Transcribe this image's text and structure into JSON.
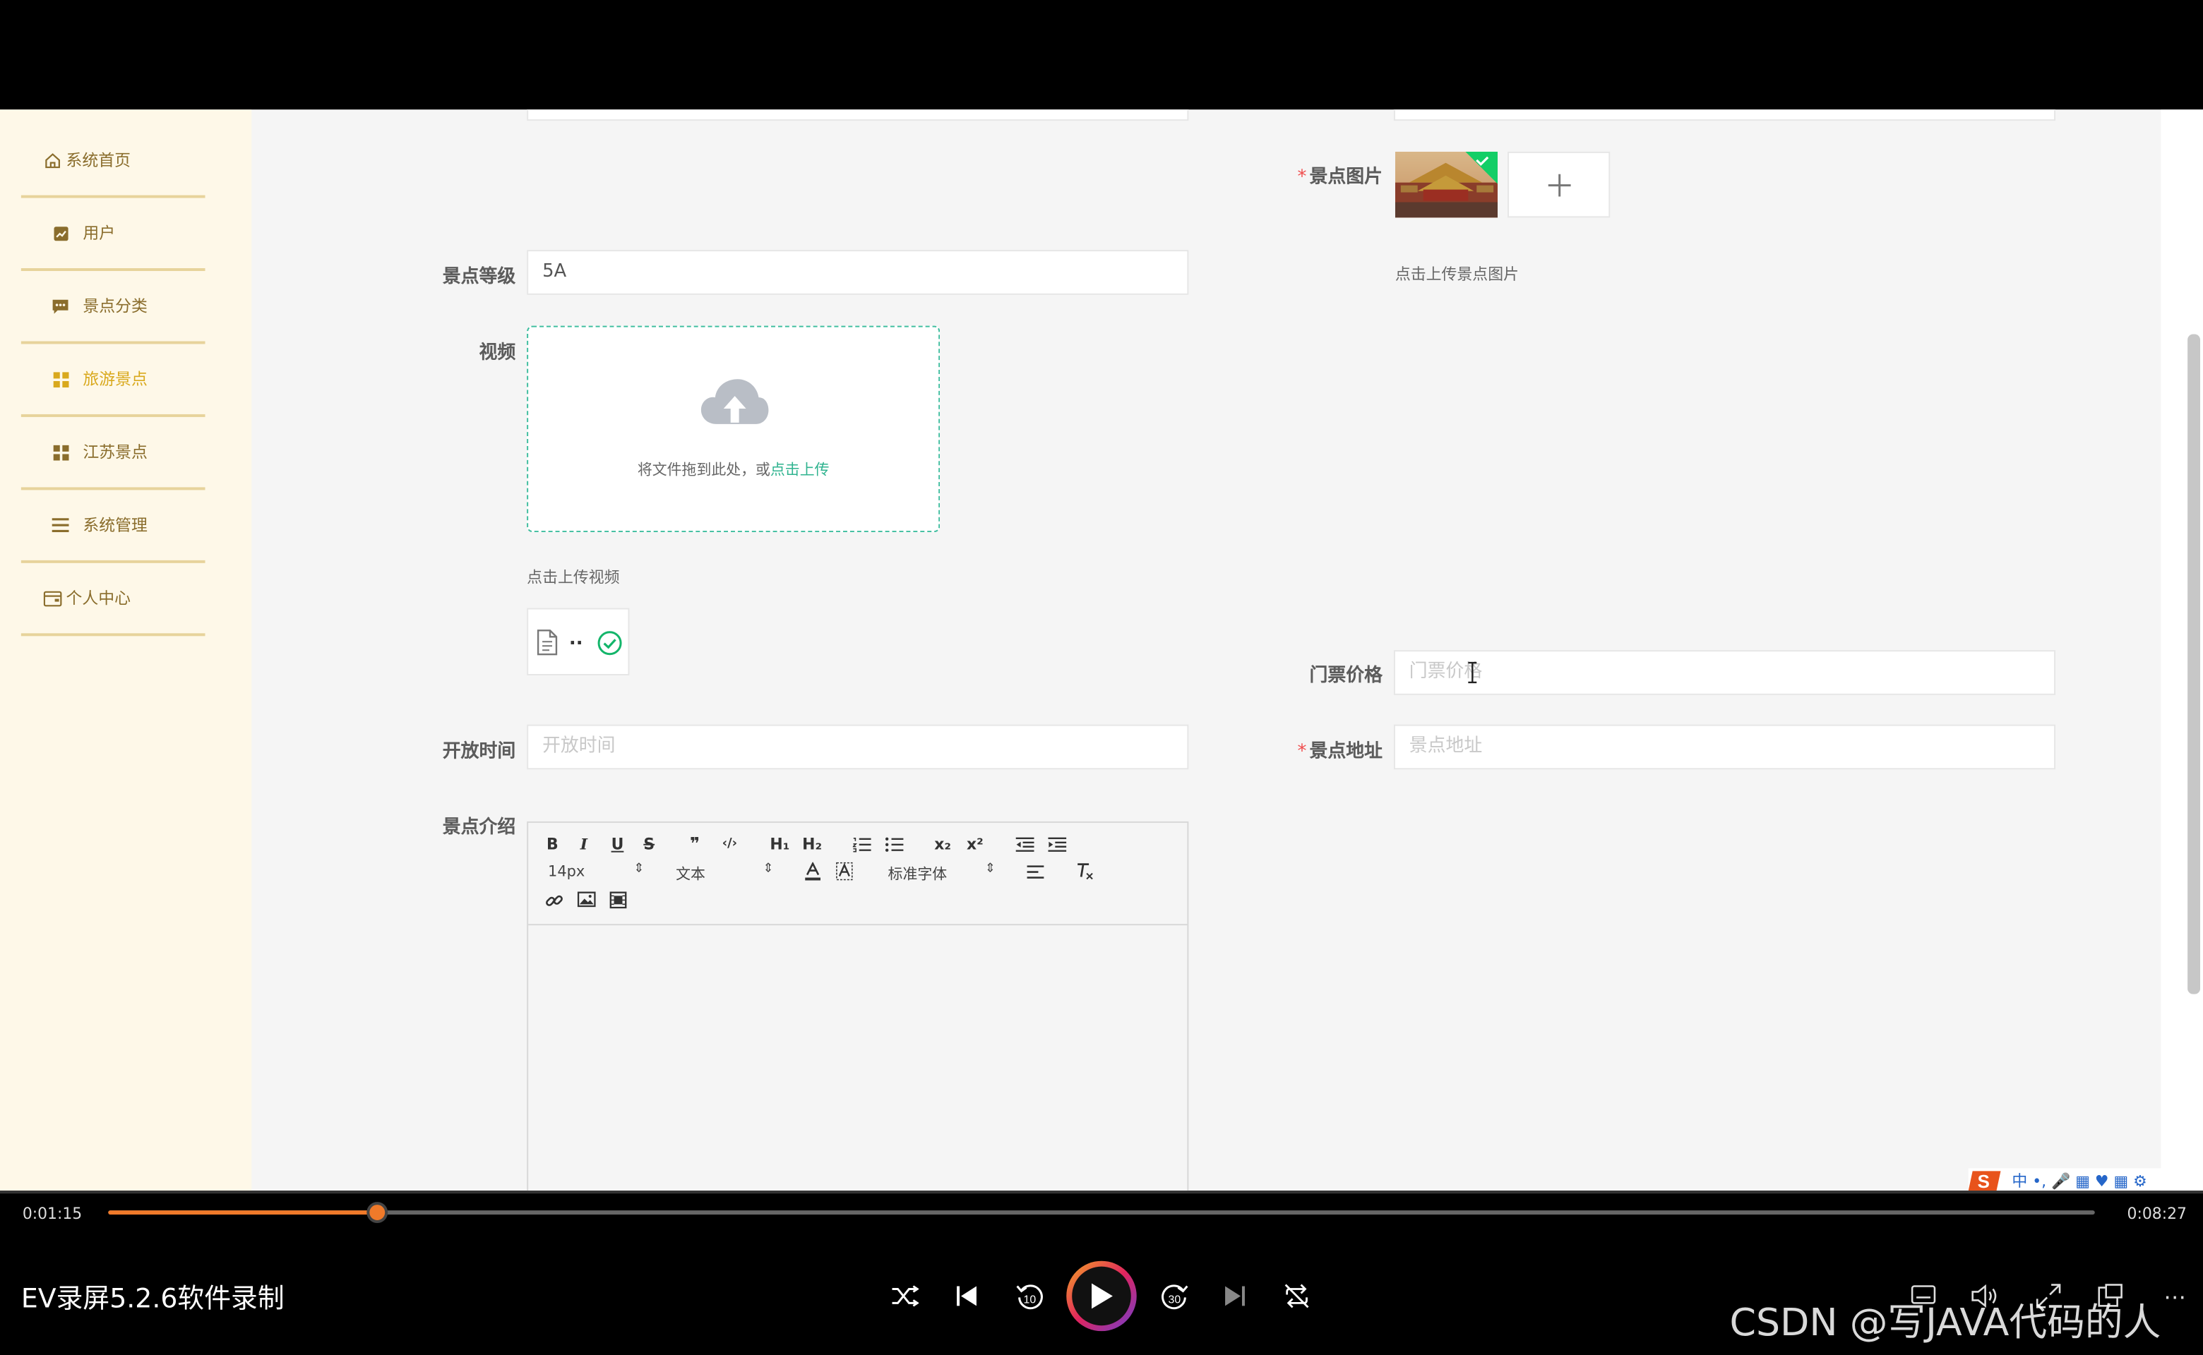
{
  "sidebar": {
    "items": [
      {
        "label": "系统首页",
        "icon": "home-icon"
      },
      {
        "label": "用户",
        "icon": "chart-icon"
      },
      {
        "label": "景点分类",
        "icon": "comment-icon"
      },
      {
        "label": "旅游景点",
        "icon": "grid-icon",
        "active": true
      },
      {
        "label": "江苏景点",
        "icon": "grid-icon"
      },
      {
        "label": "系统管理",
        "icon": "menu-icon"
      },
      {
        "label": "个人中心",
        "icon": "wallet-icon"
      }
    ]
  },
  "form": {
    "image_label": "景点图片",
    "image_hint": "点击上传景点图片",
    "level_label": "景点等级",
    "level_value": "5A",
    "video_label": "视频",
    "video_drag_text": "将文件拖到此处，或",
    "video_click_text": "点击上传",
    "video_hint": "点击上传视频",
    "video_file_name": "..",
    "price_label": "门票价格",
    "price_placeholder": "门票价格",
    "open_label": "开放时间",
    "open_placeholder": "开放时间",
    "address_label": "景点地址",
    "address_placeholder": "景点地址",
    "intro_label": "景点介绍"
  },
  "editor": {
    "font_size": "14px",
    "header": "文本",
    "font_family": "标准字体",
    "buttons": [
      "B",
      "I",
      "U",
      "S",
      "❞",
      "‹/›",
      "H₁",
      "H₂",
      "x₂",
      "x²"
    ]
  },
  "player": {
    "current_time": "0:01:15",
    "total_time": "0:08:27",
    "progress": 0.135,
    "title": "EV录屏5.2.6软件录制",
    "watermark": "CSDN @写JAVA代码的人"
  },
  "colors": {
    "accent": "#d9a91d",
    "sidebar_bg": "#fef8e8",
    "upload_border": "#3dbd9e",
    "progress": "#f07a2a"
  }
}
